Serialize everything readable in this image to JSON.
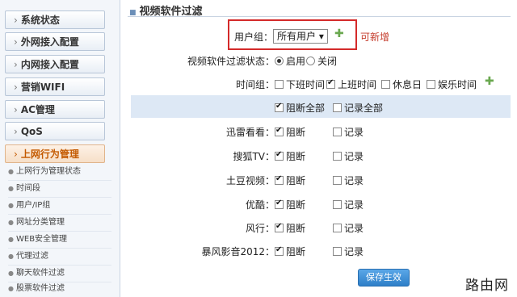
{
  "sidebar": {
    "items": [
      {
        "label": "系统状态"
      },
      {
        "label": "外网接入配置"
      },
      {
        "label": "内网接入配置"
      },
      {
        "label": "营销WIFI"
      },
      {
        "label": "AC管理"
      },
      {
        "label": "QoS"
      },
      {
        "label": "上网行为管理"
      }
    ],
    "sub_items": [
      {
        "label": "上网行为管理状态"
      },
      {
        "label": "时间段"
      },
      {
        "label": "用户/IP组"
      },
      {
        "label": "网址分类管理"
      },
      {
        "label": "WEB安全管理"
      },
      {
        "label": "代理过滤"
      },
      {
        "label": "聊天软件过滤"
      },
      {
        "label": "股票软件过滤"
      }
    ]
  },
  "page": {
    "title": "视频软件过滤",
    "user_group": {
      "label": "用户组：",
      "value": "所有用户 ▾",
      "note": "可新增"
    },
    "status": {
      "label": "视频软件过滤状态：",
      "on": "启用",
      "off": "关闭"
    },
    "time_group": {
      "label": "时间组：",
      "options": [
        "下班时间",
        "上班时间",
        "休息日",
        "娱乐时间"
      ],
      "checked": [
        false,
        true,
        false,
        false
      ]
    },
    "bulk": {
      "block_all": "阻断全部",
      "log_all": "记录全部"
    },
    "apps": [
      {
        "name": "迅雷看看：",
        "block": "阻断",
        "log": "记录"
      },
      {
        "name": "搜狐TV：",
        "block": "阻断",
        "log": "记录"
      },
      {
        "name": "土豆视频：",
        "block": "阻断",
        "log": "记录"
      },
      {
        "name": "优酷：",
        "block": "阻断",
        "log": "记录"
      },
      {
        "name": "风行：",
        "block": "阻断",
        "log": "记录"
      },
      {
        "name": "暴风影音2012：",
        "block": "阻断",
        "log": "记录"
      }
    ],
    "save_label": "保存生效"
  },
  "watermark": "路由网",
  "colors": {
    "accent": "#c45a00",
    "highlight_border": "#d42a2a",
    "band": "#dde8f5",
    "button": "#2e7fc8"
  }
}
